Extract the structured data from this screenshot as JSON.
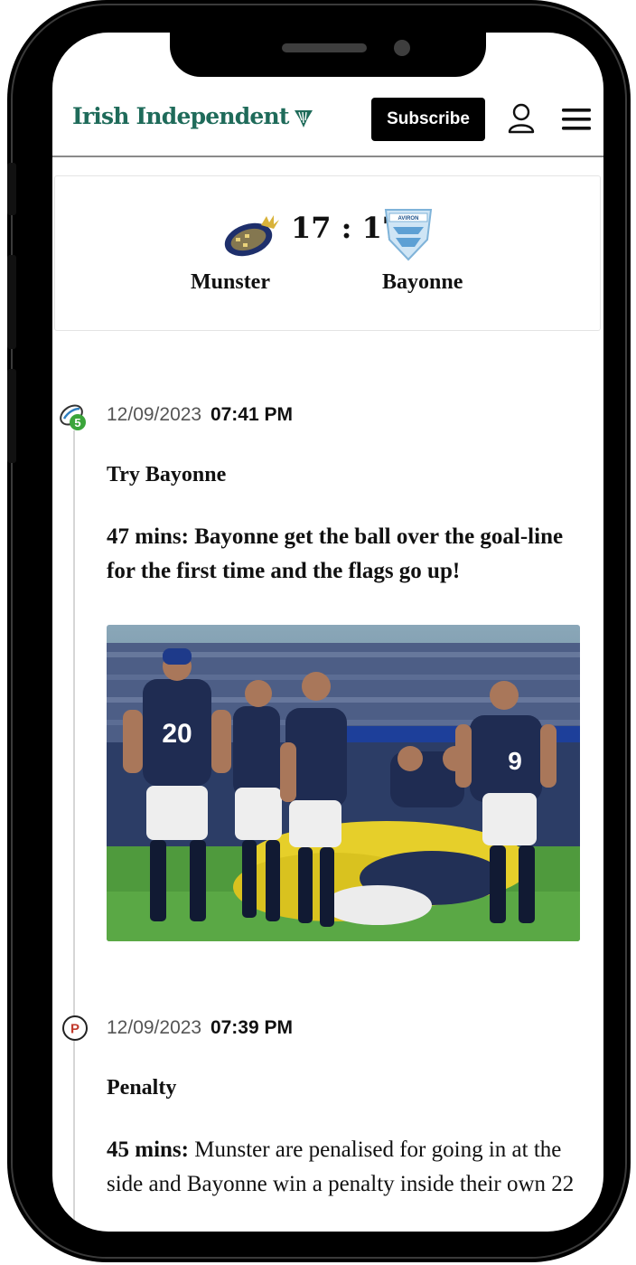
{
  "header": {
    "logo_text": "Irish Independent",
    "subscribe_label": "Subscribe",
    "brand_color": "#1f6b5a"
  },
  "match": {
    "score": "17 : 17",
    "home_team": "Munster",
    "away_team": "Bayonne",
    "away_logo_text": "AVIRON"
  },
  "posts": [
    {
      "date": "12/09/2023",
      "time": "07:41 PM",
      "badge": "5",
      "badge_color": "#3aa53a",
      "title": "Try Bayonne",
      "body": "47 mins: Bayonne get the ball over the goal-line for the first time and the flags go up!",
      "icon": "try-icon",
      "photo_numbers": [
        "20",
        "9"
      ]
    },
    {
      "date": "12/09/2023",
      "time": "07:39 PM",
      "badge": "P",
      "badge_color": "#c0392b",
      "title": "Penalty",
      "body_lead": "45 mins:",
      "body": "Munster are penalised for going in at the side and Bayonne win a penalty inside their own 22",
      "icon": "penalty-icon"
    }
  ]
}
